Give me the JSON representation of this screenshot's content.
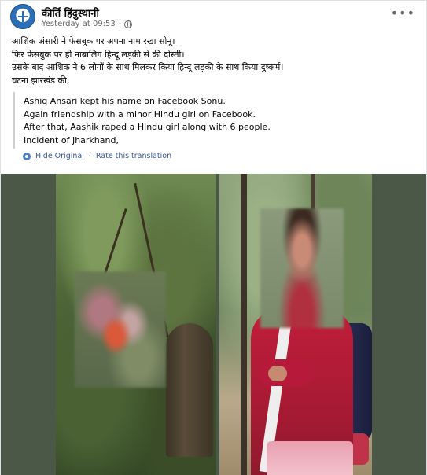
{
  "post": {
    "author": "कीर्ति हिंदुस्थानी",
    "timestamp": "Yesterday at 09:53",
    "more_icon": "more-horizontal-icon",
    "privacy_icon": "globe-icon",
    "text_lines": [
      "आशिक अंसारी ने फेसबुक पर अपना नाम रखा सोनू।",
      "फिर फेसबुक पर ही नाबालिग हिन्दू लड़की से की दोस्ती।",
      "उसके बाद आशिक ने 6 लोगों के साथ मिलकर किया हिन्दू लड़की के साथ किया दुष्कर्म।",
      "घटना झारखंड की,"
    ],
    "translation_lines": [
      "Ashiq Ansari kept his name on Facebook Sonu.",
      "Again friendship with a minor Hindu girl on Facebook.",
      "After that, Aashik raped a Hindu girl along with 6 people.",
      "Incident of Jharkhand,"
    ],
    "translate_icon": "gear-icon",
    "hide_original_label": "Hide Original",
    "separator": "·",
    "rate_translation_label": "Rate this translation"
  },
  "colors": {
    "link": "#385898",
    "secondary_text": "#65676b",
    "photo_background": "#4b5848"
  }
}
